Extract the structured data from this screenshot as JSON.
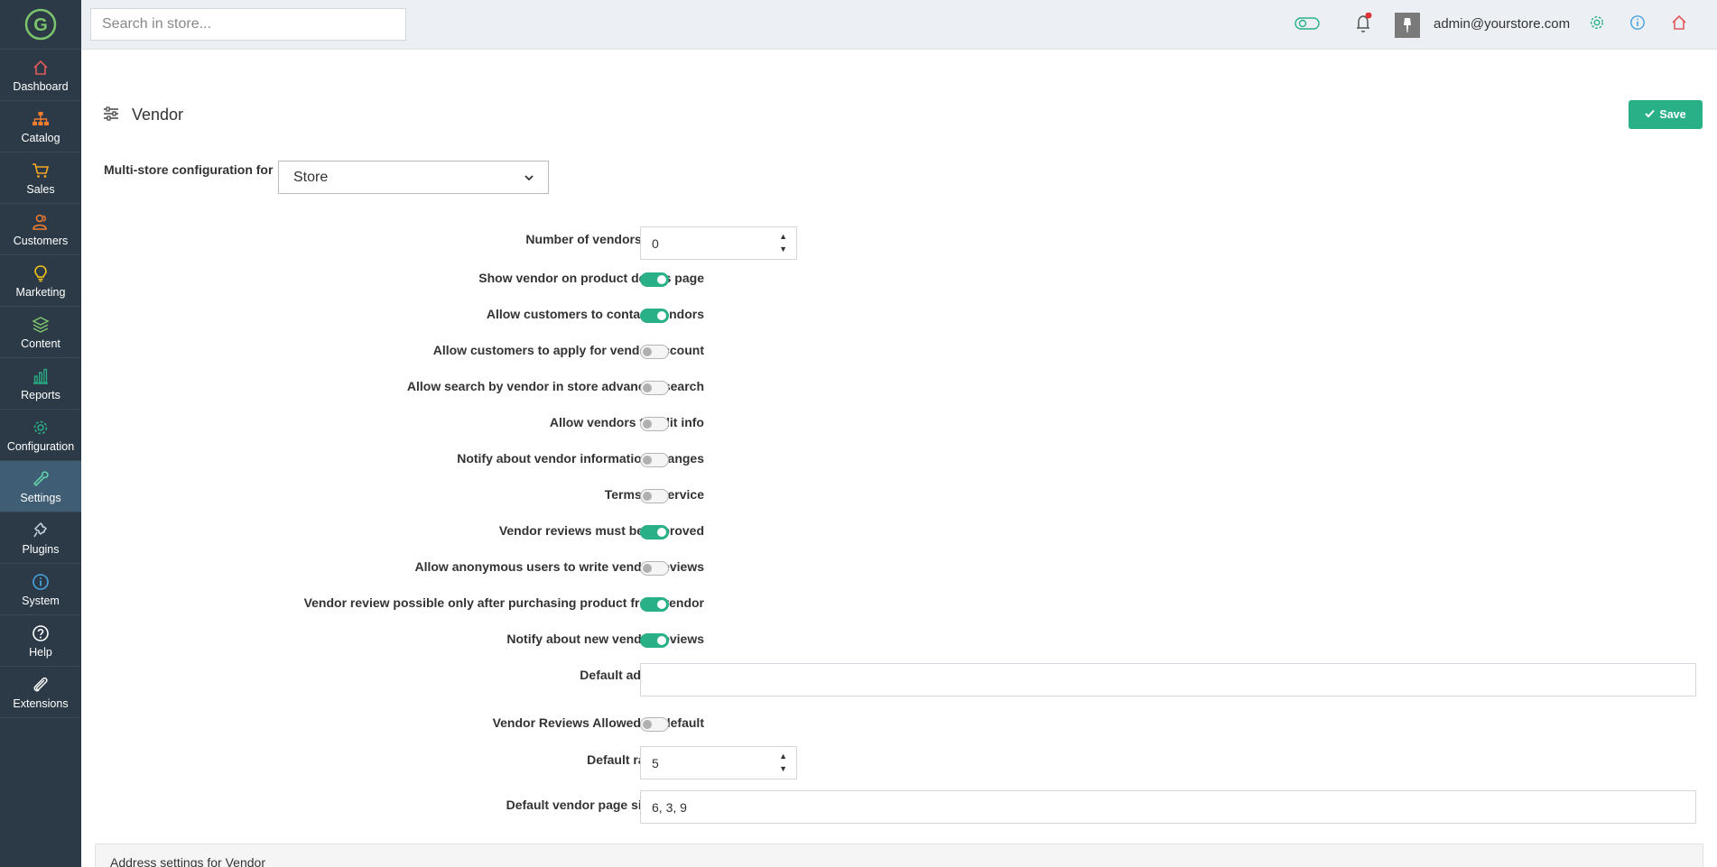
{
  "sidebar": {
    "logo": "G",
    "items": [
      {
        "label": "Dashboard",
        "icon": "home-icon",
        "color": "#e05a5a"
      },
      {
        "label": "Catalog",
        "icon": "sitemap-icon",
        "color": "#f07c30"
      },
      {
        "label": "Sales",
        "icon": "cart-icon",
        "color": "#f5a623"
      },
      {
        "label": "Customers",
        "icon": "users-icon",
        "color": "#f07c30"
      },
      {
        "label": "Marketing",
        "icon": "lightbulb-icon",
        "color": "#f5c518"
      },
      {
        "label": "Content",
        "icon": "layers-icon",
        "color": "#7cc46c"
      },
      {
        "label": "Reports",
        "icon": "bar-chart-icon",
        "color": "#2ab087"
      },
      {
        "label": "Configuration",
        "icon": "gear-icon",
        "color": "#2ab087"
      },
      {
        "label": "Settings",
        "icon": "wrench-icon",
        "color": "#5fd0a8"
      },
      {
        "label": "Plugins",
        "icon": "puzzle-icon",
        "color": "#c9d6df"
      },
      {
        "label": "System",
        "icon": "info-icon",
        "color": "#4aa3df"
      },
      {
        "label": "Help",
        "icon": "question-icon",
        "color": "#ffffff"
      },
      {
        "label": "Extensions",
        "icon": "paperclip-icon",
        "color": "#ffffff"
      }
    ],
    "active_index": 8
  },
  "topbar": {
    "search_placeholder": "Search in store...",
    "user_email": "admin@yourstore.com"
  },
  "page": {
    "title": "Vendor",
    "save_label": "Save",
    "multistore_label": "Multi-store configuration for",
    "multistore_value": "Store"
  },
  "settings": {
    "num_vendors_label": "Number of vendors to display",
    "num_vendors_value": "0",
    "toggles": [
      {
        "label": "Show vendor on product details page",
        "on": true
      },
      {
        "label": "Allow customers to contact vendors",
        "on": true
      },
      {
        "label": "Allow customers to apply for vendor account",
        "on": false
      },
      {
        "label": "Allow search by vendor in store advanced search",
        "on": false
      },
      {
        "label": "Allow vendors to edit info",
        "on": false
      },
      {
        "label": "Notify about vendor information changes",
        "on": false
      },
      {
        "label": "Terms of service",
        "on": false
      },
      {
        "label": "Vendor reviews must be approved",
        "on": true
      },
      {
        "label": "Allow anonymous users to write vendor reviews",
        "on": false
      },
      {
        "label": "Vendor review possible only after purchasing product from vendor",
        "on": true
      },
      {
        "label": "Notify about new vendor reviews",
        "on": true
      }
    ],
    "admin_theme_label": "Default admin theme",
    "admin_theme_value": "",
    "reviews_allowed_label": "Vendor Reviews Allowed by default",
    "reviews_allowed_on": false,
    "rating_label": "Default rating value",
    "rating_value": "5",
    "page_size_label": "Default vendor page size options",
    "page_size_value": "6, 3, 9"
  },
  "address_panel": {
    "title": "Address settings for Vendor"
  }
}
